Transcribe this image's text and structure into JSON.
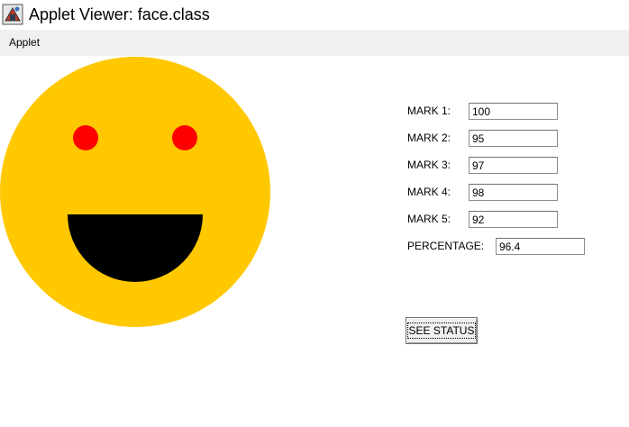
{
  "window": {
    "title": "Applet Viewer: face.class"
  },
  "menu": {
    "applet_label": "Applet"
  },
  "face": {
    "face_color": "#ffc800",
    "eye_color": "#ff0000",
    "mouth_color": "#000000"
  },
  "form": {
    "marks": [
      {
        "label": "MARK 1:",
        "value": "100"
      },
      {
        "label": "MARK 2:",
        "value": "95"
      },
      {
        "label": "MARK 3:",
        "value": "97"
      },
      {
        "label": "MARK 4:",
        "value": "98"
      },
      {
        "label": "MARK 5:",
        "value": "92"
      }
    ],
    "percentage_label": "PERCENTAGE:",
    "percentage_value": "96.4",
    "status_button_label": "SEE STATUS"
  }
}
